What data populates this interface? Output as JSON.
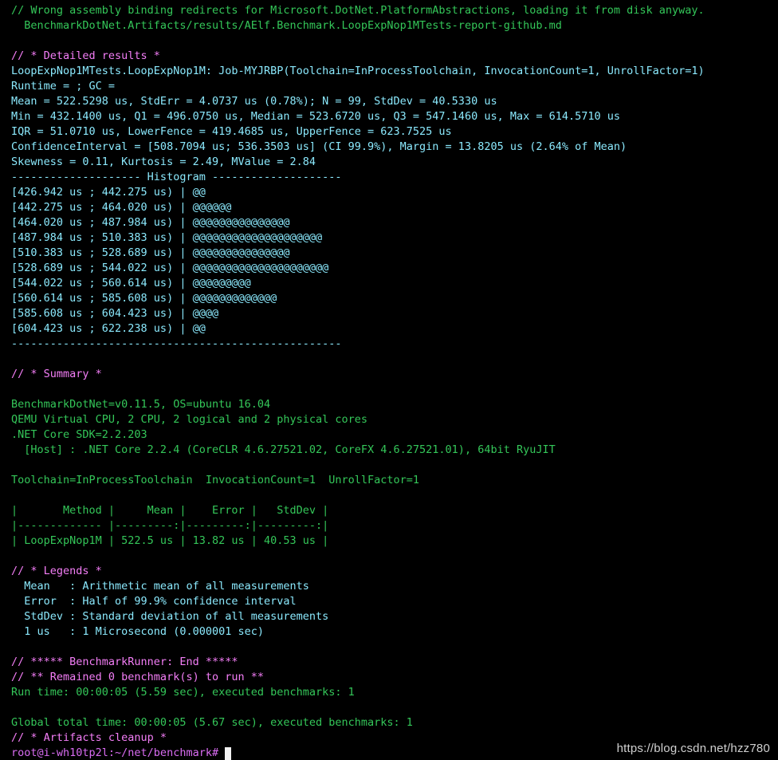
{
  "terminal": {
    "lines": [
      {
        "text": "// Wrong assembly binding redirects for Microsoft.DotNet.PlatformAbstractions, loading it from disk anyway.",
        "color": "green"
      },
      {
        "text": "  BenchmarkDotNet.Artifacts/results/AElf.Benchmark.LoopExpNop1MTests-report-github.md",
        "color": "green"
      },
      {
        "text": "",
        "color": "white"
      },
      {
        "text": "// * Detailed results *",
        "color": "magenta"
      },
      {
        "text": "LoopExpNop1MTests.LoopExpNop1M: Job-MYJRBP(Toolchain=InProcessToolchain, InvocationCount=1, UnrollFactor=1)",
        "color": "cyan"
      },
      {
        "text": "Runtime = ; GC =",
        "color": "cyan"
      },
      {
        "text": "Mean = 522.5298 us, StdErr = 4.0737 us (0.78%); N = 99, StdDev = 40.5330 us",
        "color": "cyan"
      },
      {
        "text": "Min = 432.1400 us, Q1 = 496.0750 us, Median = 523.6720 us, Q3 = 547.1460 us, Max = 614.5710 us",
        "color": "cyan"
      },
      {
        "text": "IQR = 51.0710 us, LowerFence = 419.4685 us, UpperFence = 623.7525 us",
        "color": "cyan"
      },
      {
        "text": "ConfidenceInterval = [508.7094 us; 536.3503 us] (CI 99.9%), Margin = 13.8205 us (2.64% of Mean)",
        "color": "cyan"
      },
      {
        "text": "Skewness = 0.11, Kurtosis = 2.49, MValue = 2.84",
        "color": "cyan"
      },
      {
        "text": "-------------------- Histogram --------------------",
        "color": "cyan"
      },
      {
        "text": "[426.942 us ; 442.275 us) | @@",
        "color": "cyan"
      },
      {
        "text": "[442.275 us ; 464.020 us) | @@@@@@",
        "color": "cyan"
      },
      {
        "text": "[464.020 us ; 487.984 us) | @@@@@@@@@@@@@@@",
        "color": "cyan"
      },
      {
        "text": "[487.984 us ; 510.383 us) | @@@@@@@@@@@@@@@@@@@@",
        "color": "cyan"
      },
      {
        "text": "[510.383 us ; 528.689 us) | @@@@@@@@@@@@@@@",
        "color": "cyan"
      },
      {
        "text": "[528.689 us ; 544.022 us) | @@@@@@@@@@@@@@@@@@@@@",
        "color": "cyan"
      },
      {
        "text": "[544.022 us ; 560.614 us) | @@@@@@@@@",
        "color": "cyan"
      },
      {
        "text": "[560.614 us ; 585.608 us) | @@@@@@@@@@@@@",
        "color": "cyan"
      },
      {
        "text": "[585.608 us ; 604.423 us) | @@@@",
        "color": "cyan"
      },
      {
        "text": "[604.423 us ; 622.238 us) | @@",
        "color": "cyan"
      },
      {
        "text": "---------------------------------------------------",
        "color": "cyan"
      },
      {
        "text": "",
        "color": "white"
      },
      {
        "text": "// * Summary *",
        "color": "magenta"
      },
      {
        "text": "",
        "color": "white"
      },
      {
        "text": "BenchmarkDotNet=v0.11.5, OS=ubuntu 16.04",
        "color": "green"
      },
      {
        "text": "QEMU Virtual CPU, 2 CPU, 2 logical and 2 physical cores",
        "color": "green"
      },
      {
        "text": ".NET Core SDK=2.2.203",
        "color": "green"
      },
      {
        "text": "  [Host] : .NET Core 2.2.4 (CoreCLR 4.6.27521.02, CoreFX 4.6.27521.01), 64bit RyuJIT",
        "color": "green"
      },
      {
        "text": "",
        "color": "white"
      },
      {
        "text": "Toolchain=InProcessToolchain  InvocationCount=1  UnrollFactor=1",
        "color": "green"
      },
      {
        "text": "",
        "color": "white"
      },
      {
        "text": "|       Method |     Mean |    Error |   StdDev |",
        "color": "green"
      },
      {
        "text": "|------------- |---------:|---------:|---------:|",
        "color": "green"
      },
      {
        "text": "| LoopExpNop1M | 522.5 us | 13.82 us | 40.53 us |",
        "color": "green"
      },
      {
        "text": "",
        "color": "white"
      },
      {
        "text": "// * Legends *",
        "color": "magenta"
      },
      {
        "text": "  Mean   : Arithmetic mean of all measurements",
        "color": "cyan"
      },
      {
        "text": "  Error  : Half of 99.9% confidence interval",
        "color": "cyan"
      },
      {
        "text": "  StdDev : Standard deviation of all measurements",
        "color": "cyan"
      },
      {
        "text": "  1 us   : 1 Microsecond (0.000001 sec)",
        "color": "cyan"
      },
      {
        "text": "",
        "color": "white"
      },
      {
        "text": "// ***** BenchmarkRunner: End *****",
        "color": "magenta"
      },
      {
        "text": "// ** Remained 0 benchmark(s) to run **",
        "color": "magenta"
      },
      {
        "text": "Run time: 00:00:05 (5.59 sec), executed benchmarks: 1",
        "color": "green"
      },
      {
        "text": "",
        "color": "white"
      },
      {
        "text": "Global total time: 00:00:05 (5.67 sec), executed benchmarks: 1",
        "color": "green"
      },
      {
        "text": "// * Artifacts cleanup *",
        "color": "magenta"
      }
    ],
    "prompt": "root@i-wh10tp2l:~/net/benchmark#"
  },
  "watermark": "https://blog.csdn.net/hzz780",
  "colors": {
    "green": "#34c759",
    "cyan": "#8be9fd",
    "magenta": "#f47ef7",
    "white": "#eaeaea",
    "prompt": "#d96cf2",
    "background": "#000000"
  }
}
